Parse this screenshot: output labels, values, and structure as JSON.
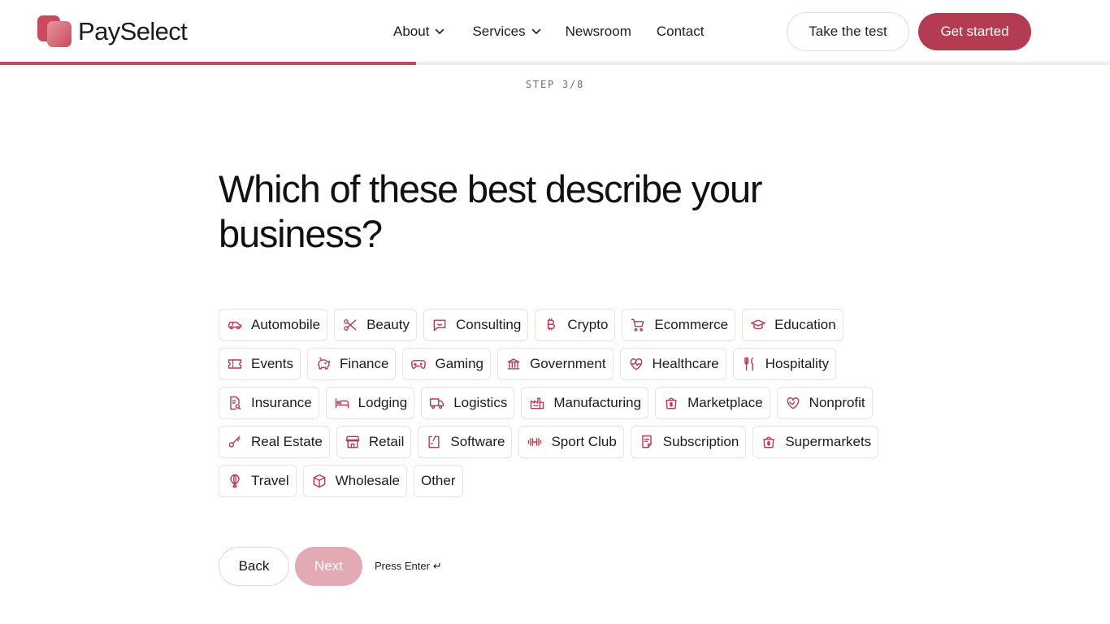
{
  "brand": {
    "name": "PaySelect",
    "accent": "#b43c52",
    "accent_light": "#e3aab4",
    "icon_color": "#b43c52"
  },
  "nav": {
    "about": "About",
    "services": "Services",
    "newsroom": "Newsroom",
    "contact": "Contact"
  },
  "header_buttons": {
    "take_test": "Take the test",
    "get_started": "Get started"
  },
  "progress": {
    "step_label": "STEP 3/8",
    "fraction": 0.375
  },
  "question": "Which of these best describe your business?",
  "options": [
    [
      {
        "label": "Automobile",
        "icon": "car-icon"
      },
      {
        "label": "Beauty",
        "icon": "scissors-icon"
      },
      {
        "label": "Consulting",
        "icon": "chat-icon"
      },
      {
        "label": "Crypto",
        "icon": "bitcoin-icon"
      },
      {
        "label": "Ecommerce",
        "icon": "cart-icon"
      },
      {
        "label": "Education",
        "icon": "graduation-cap-icon"
      }
    ],
    [
      {
        "label": "Events",
        "icon": "ticket-icon"
      },
      {
        "label": "Finance",
        "icon": "piggy-bank-icon"
      },
      {
        "label": "Gaming",
        "icon": "gamepad-icon"
      },
      {
        "label": "Government",
        "icon": "bank-building-icon"
      },
      {
        "label": "Healthcare",
        "icon": "heart-pulse-icon"
      },
      {
        "label": "Hospitality",
        "icon": "fork-knife-icon"
      }
    ],
    [
      {
        "label": "Insurance",
        "icon": "document-search-icon"
      },
      {
        "label": "Lodging",
        "icon": "bed-icon"
      },
      {
        "label": "Logistics",
        "icon": "truck-icon"
      },
      {
        "label": "Manufacturing",
        "icon": "factory-icon"
      },
      {
        "label": "Marketplace",
        "icon": "shopping-bag-icon"
      },
      {
        "label": "Nonprofit",
        "icon": "heart-hand-icon"
      }
    ],
    [
      {
        "label": "Real Estate",
        "icon": "key-icon"
      },
      {
        "label": "Retail",
        "icon": "store-icon"
      },
      {
        "label": "Software",
        "icon": "code-window-icon"
      },
      {
        "label": "Sport Club",
        "icon": "dumbbell-icon"
      },
      {
        "label": "Subscription",
        "icon": "receipt-icon"
      },
      {
        "label": "Supermarkets",
        "icon": "dollar-bag-icon"
      }
    ],
    [
      {
        "label": "Travel",
        "icon": "hot-air-balloon-icon"
      },
      {
        "label": "Wholesale",
        "icon": "box-icon"
      },
      {
        "label": "Other",
        "icon": ""
      }
    ]
  ],
  "actions": {
    "back": "Back",
    "next": "Next",
    "hint": "Press Enter",
    "hint_symbol": "↵"
  }
}
